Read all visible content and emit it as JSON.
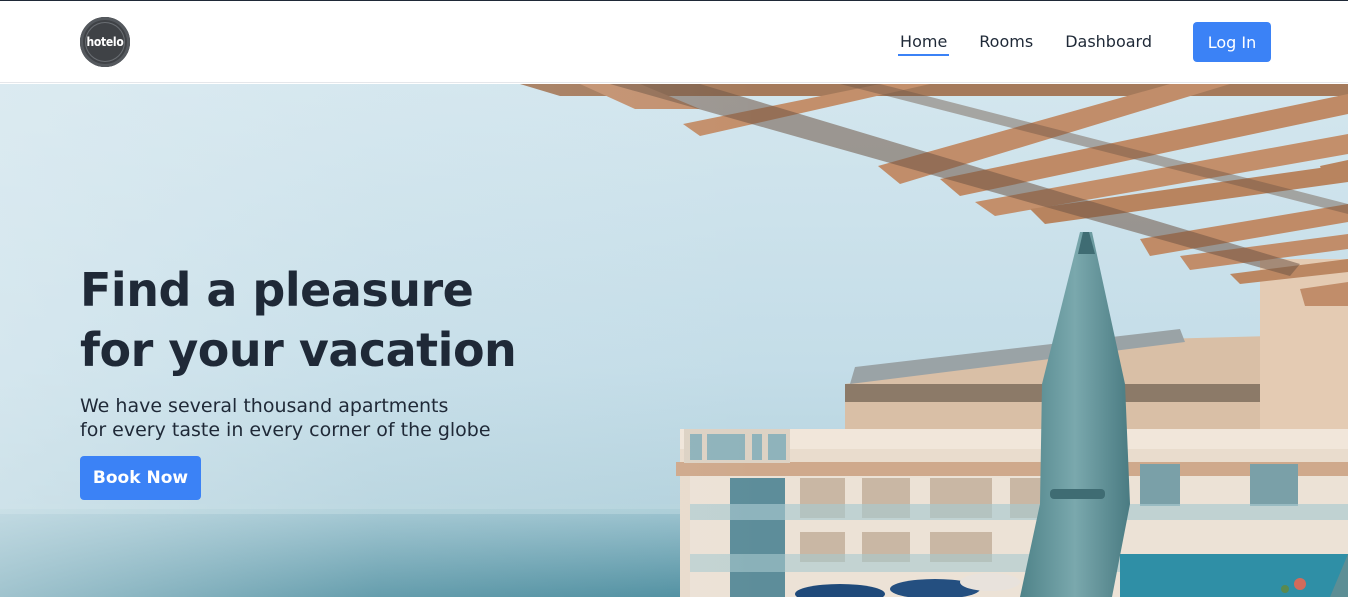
{
  "brand": {
    "logo_text": "hotelo"
  },
  "nav": {
    "items": [
      {
        "label": "Home",
        "active": true
      },
      {
        "label": "Rooms",
        "active": false
      },
      {
        "label": "Dashboard",
        "active": false
      }
    ],
    "login_label": "Log In"
  },
  "hero": {
    "title_line1": "Find a pleasure",
    "title_line2": "for your vacation",
    "subtitle_line1": "We have several thousand apartments",
    "subtitle_line2": "for every taste in every corner of the globe",
    "cta_label": "Book Now"
  },
  "colors": {
    "accent": "#3b82f6",
    "text": "#1f2937",
    "sky": "#c9e2ec",
    "sea": "#5b98a8"
  }
}
